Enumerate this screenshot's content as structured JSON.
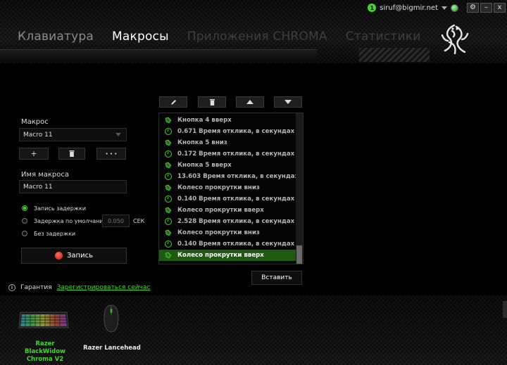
{
  "header": {
    "notification_count": "1",
    "account": "siruf@bigmir.net",
    "window_buttons": {
      "settings": "⚙",
      "minimize": "–",
      "close": "x"
    },
    "tabs": [
      {
        "label": "Клавиатура",
        "state": "inactive"
      },
      {
        "label": "Макросы",
        "state": "active"
      },
      {
        "label": "Приложения CHROMA",
        "state": "disabled"
      },
      {
        "label": "Статистики",
        "state": "disabled"
      }
    ]
  },
  "macro_panel": {
    "macro_label": "Макрос",
    "macro_selected": "Macro 11",
    "add_label": "+",
    "more_label": "• • •",
    "name_label": "Имя макроса",
    "name_value": "Macro 11",
    "delay_options": [
      {
        "label": "Запись задержки",
        "selected": true
      },
      {
        "label": "Задержка по умолчанию",
        "selected": false
      },
      {
        "label": "Без задержки",
        "selected": false
      }
    ],
    "default_delay_value": "0.050",
    "delay_unit": "СЕК",
    "record_label": "Запись"
  },
  "event_list": {
    "items": [
      {
        "icon": "mouse-icon",
        "text": "Кнопка 4 вверх",
        "selected": false
      },
      {
        "icon": "clock-icon",
        "text": "0.671 Время отклика, в секундах",
        "selected": false
      },
      {
        "icon": "mouse-icon",
        "text": "Кнопка 5 вниз",
        "selected": false
      },
      {
        "icon": "clock-icon",
        "text": "0.172 Время отклика, в секундах",
        "selected": false
      },
      {
        "icon": "mouse-icon",
        "text": "Кнопка 5 вверх",
        "selected": false
      },
      {
        "icon": "clock-icon",
        "text": "13.603 Время отклика, в секундах",
        "selected": false
      },
      {
        "icon": "mouse-icon",
        "text": "Колесо прокрутки вниз",
        "selected": false
      },
      {
        "icon": "clock-icon",
        "text": "0.140 Время отклика, в секундах",
        "selected": false
      },
      {
        "icon": "mouse-icon",
        "text": "Колесо прокрутки вверх",
        "selected": false
      },
      {
        "icon": "clock-icon",
        "text": "2.528 Время отклика, в секундах",
        "selected": false
      },
      {
        "icon": "mouse-icon",
        "text": "Колесо прокрутки вниз",
        "selected": false
      },
      {
        "icon": "clock-icon",
        "text": "0.140 Время отклика, в секундах",
        "selected": false
      },
      {
        "icon": "mouse-icon",
        "text": "Колесо прокрутки вверх",
        "selected": true
      }
    ],
    "insert_label": "Вставить"
  },
  "warranty": {
    "info_glyph": "i",
    "label": "Гарантия",
    "link": "Зарегистрироваться сейчас"
  },
  "devices": [
    {
      "line1": "Razer BlackWidow",
      "line2": "Chroma V2",
      "active": true
    },
    {
      "line1": "Razer Lancehead",
      "line2": "",
      "active": false
    }
  ],
  "colors": {
    "accent": "#44d62c",
    "selected_row": "#1e5a12",
    "record_dot": "#e0241a"
  }
}
